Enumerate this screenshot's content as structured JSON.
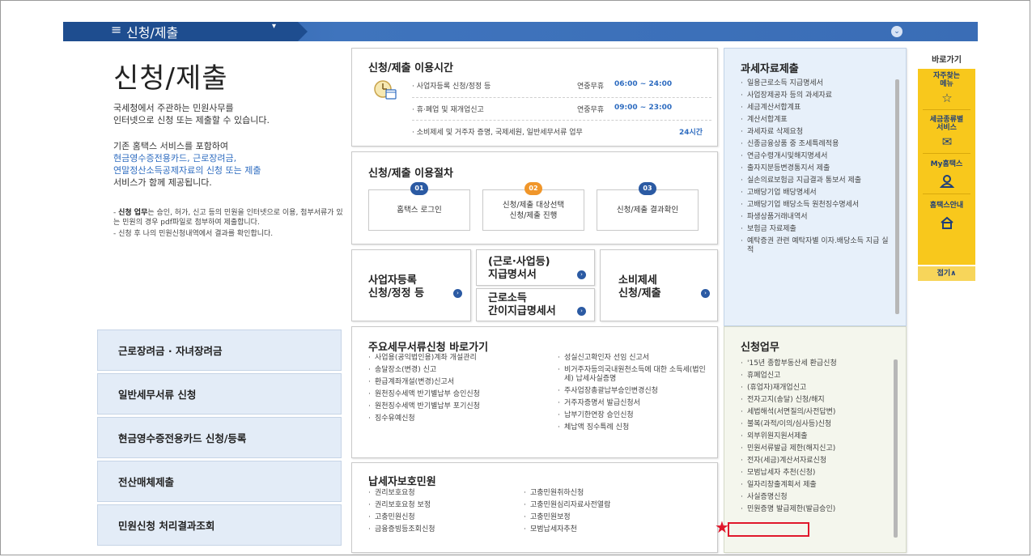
{
  "topbar": {
    "menu_glyph": "≡",
    "menu_title": "신청/제출",
    "caret": "▾",
    "collapse_glyph": "⌄"
  },
  "intro": {
    "title": "신청/제출",
    "desc_line1": "국세청에서 주관하는 민원사무를",
    "desc_line2": "인터넷으로 신청 또는 제출할 수 있습니다.",
    "p2_line1": "기존 홈택스 서비스를 포함하여",
    "p2_link1": "현금영수증전용카드, 근로장려금,",
    "p2_link2": "연말정산소득공제자료의 신청 또는 제출",
    "p2_line4": "서비스가 함께 제공됩니다.",
    "note1_bold": "신청 업무",
    "note1_rest": "는 승인, 허가, 신고 등의 민원을 인터넷으로 이용, 첨부서류가 있는 민원의 경우 pdf파일로 첨부하여 제출합니다.",
    "note2": "신청 후 나의 민원신청내역에서 결과를 확인합니다."
  },
  "time_box": {
    "title": "신청/제출 이용시간",
    "rows": [
      {
        "label": "· 사업자등록 신청/정정 등",
        "day": "연중무휴",
        "time": "06:00 ~ 24:00"
      },
      {
        "label": "· 휴·폐업 및 재개업신고",
        "day": "연중무휴",
        "time": "09:00 ~ 23:00"
      },
      {
        "label": "· 소비제세 및 거주자 증명, 국제세원, 일반세무서류 업무",
        "day": "",
        "time": "24시간"
      }
    ]
  },
  "proc_box": {
    "title": "신청/제출 이용절차",
    "steps": [
      {
        "num": "01",
        "label": "홈택스 로그인",
        "color": "#2b5aa3"
      },
      {
        "num": "02",
        "label_line1": "신청/제출 대상선택",
        "label_line2": "신청/제출 진행",
        "color": "#f0962a"
      },
      {
        "num": "03",
        "label": "신청/제출 결과확인",
        "color": "#2b5aa3"
      }
    ]
  },
  "cards": {
    "biz_reg_line1": "사업자등록",
    "biz_reg_line2": "신청/정정 등",
    "labor_line1": "(근로·사업등)",
    "labor_line2": "지급명서서",
    "simple_line1": "근로소득",
    "simple_line2": "간이지급명세서",
    "consume_line1": "소비제세",
    "consume_line2": "신청/제출",
    "go": "›"
  },
  "tax_box": {
    "title": "과세자료제출",
    "items": [
      "일용근로소득 지급명세서",
      "사업장제공자 등의 과세자료",
      "세금계산서합계표",
      "계산서합계표",
      "과세자료 삭제요청",
      "신종금융상품 중 조세특례적용",
      "연금수령개시및해지명세서",
      "출자지분등변경통지서 제출",
      "실손의료보험금 지급결과 통보서 제출",
      "고배당기업 배당명세서",
      "고배당기업 배당소득 원천징수명세서",
      "파생상품거래내역서",
      "보험금 자료제출",
      "예탁증권 관련 예탁자별 이자.배당소득 지급 실적"
    ]
  },
  "left_buttons": [
    "근로장려금 · 자녀장려금",
    "일반세무서류 신청",
    "현금영수증전용카드 신청/등록",
    "전산매체제출",
    "민원신청 처리결과조회"
  ],
  "docs_box": {
    "title": "주요세무서류신청 바로가기",
    "col1": [
      "사업용(공익법인용)계좌 개설관리",
      "송달장소(변경) 신고",
      "환급계좌개설(변경)신고서",
      "원천징수세액 반기별납부 승인신청",
      "원천징수세액 반기별납부 포기신청",
      "징수유예신청"
    ],
    "col2": [
      "성실신고확인자 선임 신고서",
      "비거주자등의국내원천소득에 대한 소득세(법인세) 납세사실증명",
      "주사업장총괄납부승인변경신청",
      "거주자증명서 발급신청서",
      "납부기한연장 승인신청",
      "체납액 징수특례 신청"
    ]
  },
  "prot_box": {
    "title": "납세자보호민원",
    "col1": [
      "권리보호요청",
      "권리보호요청 보정",
      "고충민원신청",
      "금융증빙등조회신청"
    ],
    "col2": [
      "고충민원취하신청",
      "고충민원심리자료사전열람",
      "고충민원보정",
      "모범납세자추천"
    ]
  },
  "apply_box": {
    "title": "신청업무",
    "items": [
      "'15년 종합부동산세 환급신청",
      "휴폐업신고",
      "(휴업자)재개업신고",
      "전자고지(송달) 신청/해지",
      "세법해석(서면질의/사전답변)",
      "불복(과적/이의/심사등)신청",
      "외부위원지원서제출",
      "민원서류발급 제한(해지신고)",
      "전자(세금)계산서자료신청",
      "모범납세자 추천(신청)",
      "일자리창출계획서 제출",
      "사실증명신청"
    ],
    "partial_item": "민원증명 발급제한(발급승인)"
  },
  "quick": {
    "head": "바로가기",
    "item1_line1": "자주찾는",
    "item1_line2": "메뉴",
    "item2_line1": "세금종류별",
    "item2_line2": "서비스",
    "item3": "My홈택스",
    "item4": "홈택스안내",
    "close": "접기∧",
    "icons": {
      "item1": "star-icon",
      "item2": "mail-icon",
      "item3": "person-icon",
      "item4": "home-icon"
    }
  },
  "colors": {
    "accent_blue": "#2e6cc0",
    "brand_navy": "#1e4d8f",
    "quick_yellow": "#f8c81c",
    "highlight_red": "#e0182c"
  }
}
